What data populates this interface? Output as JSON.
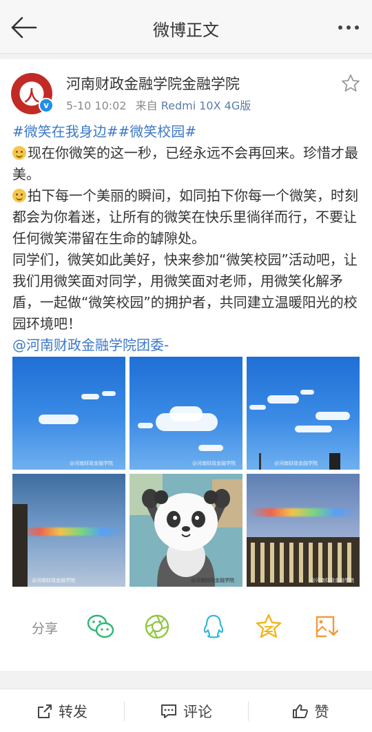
{
  "header": {
    "title": "微博正文",
    "back_icon": "back-arrow-icon",
    "more_icon": "more-dots-icon"
  },
  "post": {
    "avatar_mark": "人",
    "author": "河南财政金融学院金融学院",
    "verified_badge": "v",
    "time": "5-10 10:02",
    "source_prefix": "来自",
    "source": "Redmi 10X 4G版",
    "tags": "#微笑在我身边##微笑校园#",
    "para1": "现在你微笑的这一秒，已经永远不会再回来。珍惜才最美。",
    "para2": "拍下每一个美丽的瞬间，如同拍下你每一个微笑，时刻都会为你着迷，让所有的微笑在快乐里徜徉而行，不要让任何微笑滞留在生命的罅隙处。",
    "para3": "同学们，微笑如此美好，快来参加“微笑校园”活动吧，让我们用微笑面对同学，用微笑面对老师，用微笑化解矛盾，一起做“微笑校园”的拥护者，共同建立温暖阳光的校园环境吧！",
    "mention": "@河南财政金融学院团委-",
    "watermark": "@河南财政金融学院"
  },
  "share": {
    "label": "分享",
    "targets": [
      "wechat-icon",
      "moments-icon",
      "qq-icon",
      "qzone-icon",
      "save-image-icon"
    ]
  },
  "bottom": {
    "repost": "转发",
    "comment": "评论",
    "like": "赞"
  },
  "colors": {
    "link": "#3c78c8",
    "wechat": "#2bb673",
    "moments": "#8dc63f",
    "qq": "#35b6d8",
    "qzone": "#f2b51c",
    "save": "#f29b38"
  }
}
